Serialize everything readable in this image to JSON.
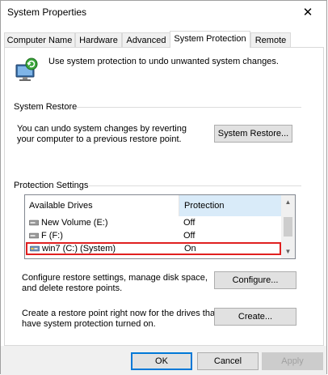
{
  "window": {
    "title": "System Properties",
    "close_glyph": "✕"
  },
  "tabs": [
    {
      "label": "Computer Name",
      "active": false
    },
    {
      "label": "Hardware",
      "active": false
    },
    {
      "label": "Advanced",
      "active": false
    },
    {
      "label": "System Protection",
      "active": true
    },
    {
      "label": "Remote",
      "active": false
    }
  ],
  "intro": {
    "icon": "system-protection-icon",
    "text": "Use system protection to undo unwanted system changes."
  },
  "system_restore": {
    "group_label": "System Restore",
    "description_line1": "You can undo system changes by reverting",
    "description_line2": "your computer to a previous restore point.",
    "button_label": "System Restore..."
  },
  "protection": {
    "group_label": "Protection Settings",
    "columns": [
      "Available Drives",
      "Protection"
    ],
    "drives": [
      {
        "name": "New Volume (E:)",
        "protection": "Off",
        "icon": "drive-icon",
        "selected": false
      },
      {
        "name": "F (F:)",
        "protection": "Off",
        "icon": "drive-icon",
        "selected": false
      },
      {
        "name": "win7 (C:) (System)",
        "protection": "On",
        "icon": "system-drive-icon",
        "selected": true
      }
    ],
    "configure_line1": "Configure restore settings, manage disk space,",
    "configure_line2": "and delete restore points.",
    "configure_button": "Configure...",
    "create_line1": "Create a restore point right now for the drives that",
    "create_line2": "have system protection turned on.",
    "create_button": "Create..."
  },
  "footer": {
    "ok": "OK",
    "cancel": "Cancel",
    "apply": "Apply"
  },
  "colors": {
    "selection_outline": "#e02020",
    "header_highlight": "#d9ebf9",
    "default_button_border": "#0078d7"
  }
}
